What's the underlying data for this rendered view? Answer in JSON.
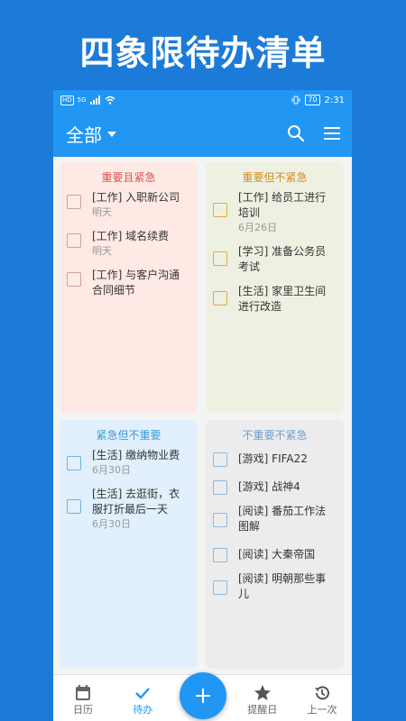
{
  "banner": {
    "title": "四象限待办清单"
  },
  "statusbar": {
    "hd": "HD",
    "signal": "5G",
    "battery": "70",
    "time": "2:31"
  },
  "appbar": {
    "filter": "全部"
  },
  "quadrants": {
    "q1": {
      "title": "重要且紧急",
      "color": "#d9534f",
      "tasks": [
        {
          "title": "[工作] 入职新公司",
          "date": "明天"
        },
        {
          "title": "[工作] 域名续费",
          "date": "明天"
        },
        {
          "title": "[工作] 与客户沟通合同细节",
          "date": ""
        }
      ]
    },
    "q2": {
      "title": "重要但不紧急",
      "color": "#d18b1f",
      "tasks": [
        {
          "title": "[工作] 给员工进行培训",
          "date": "6月26日"
        },
        {
          "title": "[学习] 准备公务员考试",
          "date": ""
        },
        {
          "title": "[生活] 家里卫生间进行改造",
          "date": ""
        }
      ]
    },
    "q3": {
      "title": "紧急但不重要",
      "color": "#3a9bd5",
      "tasks": [
        {
          "title": "[生活] 缴纳物业费",
          "date": "6月30日"
        },
        {
          "title": "[生活] 去逛街，衣服打折最后一天",
          "date": "6月30日"
        }
      ]
    },
    "q4": {
      "title": "不重要不紧急",
      "color": "#6aa0d0",
      "tasks": [
        {
          "title": "[游戏] FIFA22",
          "date": ""
        },
        {
          "title": "[游戏] 战神4",
          "date": ""
        },
        {
          "title": "[阅读] 番茄工作法图解",
          "date": ""
        },
        {
          "title": "[阅读] 大秦帝国",
          "date": ""
        },
        {
          "title": "[阅读] 明朝那些事儿",
          "date": ""
        }
      ]
    }
  },
  "bottomnav": {
    "calendar": "日历",
    "todo": "待办",
    "reminder": "提醒日",
    "last": "上一次"
  },
  "accent": "#2196f3"
}
